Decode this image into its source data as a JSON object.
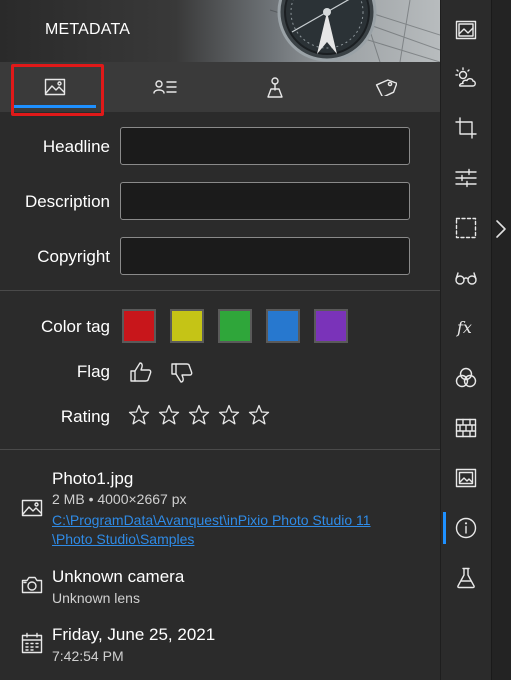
{
  "header": {
    "title": "METADATA"
  },
  "tabs": [
    {
      "name": "image-info",
      "icon": "image-icon",
      "active": true
    },
    {
      "name": "contact",
      "icon": "contact-list-icon",
      "active": false
    },
    {
      "name": "location",
      "icon": "location-pin-icon",
      "active": false
    },
    {
      "name": "keywords",
      "icon": "tag-icon",
      "active": false
    }
  ],
  "fields": {
    "headline": {
      "label": "Headline",
      "value": ""
    },
    "description": {
      "label": "Description",
      "value": ""
    },
    "copyright": {
      "label": "Copyright",
      "value": ""
    }
  },
  "tags": {
    "color_label": "Color tag",
    "colors": [
      "#c8161b",
      "#c5c416",
      "#2fa63a",
      "#2778cf",
      "#7a33b9"
    ],
    "flag_label": "Flag",
    "rating_label": "Rating",
    "rating": 0,
    "rating_max": 5
  },
  "file": {
    "name": "Photo1.jpg",
    "details": "2 MB • 4000×2667 px",
    "path_line1": "C:\\ProgramData\\Avanquest\\inPixio Photo Studio 11",
    "path_line2": "\\Photo Studio\\Samples"
  },
  "camera": {
    "name": "Unknown camera",
    "lens": "Unknown lens"
  },
  "date": {
    "day": "Friday, June 25, 2021",
    "time": "7:42:54 PM"
  },
  "toolbar": {
    "items": [
      "presets-icon",
      "sky-icon",
      "crop-icon",
      "adjust-sliders-icon",
      "selection-icon",
      "glasses-icon",
      "fx-icon",
      "color-circles-icon",
      "texture-icon",
      "frame-icon",
      "info-icon",
      "lab-flask-icon"
    ],
    "active": "info-icon"
  },
  "colors": {
    "accent": "#1e90ff",
    "link": "#2f8be6",
    "highlight": "#e01919",
    "background": "#2b2b2b"
  }
}
